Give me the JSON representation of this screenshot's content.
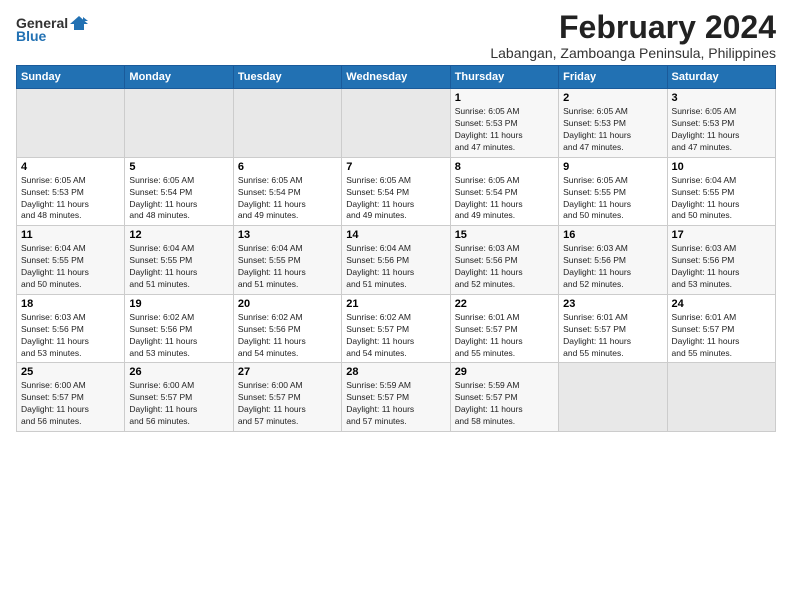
{
  "logo": {
    "text_general": "General",
    "text_blue": "Blue"
  },
  "title": "February 2024",
  "subtitle": "Labangan, Zamboanga Peninsula, Philippines",
  "days_of_week": [
    "Sunday",
    "Monday",
    "Tuesday",
    "Wednesday",
    "Thursday",
    "Friday",
    "Saturday"
  ],
  "weeks": [
    [
      {
        "day": "",
        "info": "",
        "empty": true
      },
      {
        "day": "",
        "info": "",
        "empty": true
      },
      {
        "day": "",
        "info": "",
        "empty": true
      },
      {
        "day": "",
        "info": "",
        "empty": true
      },
      {
        "day": "1",
        "info": "Sunrise: 6:05 AM\nSunset: 5:53 PM\nDaylight: 11 hours\nand 47 minutes."
      },
      {
        "day": "2",
        "info": "Sunrise: 6:05 AM\nSunset: 5:53 PM\nDaylight: 11 hours\nand 47 minutes."
      },
      {
        "day": "3",
        "info": "Sunrise: 6:05 AM\nSunset: 5:53 PM\nDaylight: 11 hours\nand 47 minutes."
      }
    ],
    [
      {
        "day": "4",
        "info": "Sunrise: 6:05 AM\nSunset: 5:53 PM\nDaylight: 11 hours\nand 48 minutes."
      },
      {
        "day": "5",
        "info": "Sunrise: 6:05 AM\nSunset: 5:54 PM\nDaylight: 11 hours\nand 48 minutes."
      },
      {
        "day": "6",
        "info": "Sunrise: 6:05 AM\nSunset: 5:54 PM\nDaylight: 11 hours\nand 49 minutes."
      },
      {
        "day": "7",
        "info": "Sunrise: 6:05 AM\nSunset: 5:54 PM\nDaylight: 11 hours\nand 49 minutes."
      },
      {
        "day": "8",
        "info": "Sunrise: 6:05 AM\nSunset: 5:54 PM\nDaylight: 11 hours\nand 49 minutes."
      },
      {
        "day": "9",
        "info": "Sunrise: 6:05 AM\nSunset: 5:55 PM\nDaylight: 11 hours\nand 50 minutes."
      },
      {
        "day": "10",
        "info": "Sunrise: 6:04 AM\nSunset: 5:55 PM\nDaylight: 11 hours\nand 50 minutes."
      }
    ],
    [
      {
        "day": "11",
        "info": "Sunrise: 6:04 AM\nSunset: 5:55 PM\nDaylight: 11 hours\nand 50 minutes."
      },
      {
        "day": "12",
        "info": "Sunrise: 6:04 AM\nSunset: 5:55 PM\nDaylight: 11 hours\nand 51 minutes."
      },
      {
        "day": "13",
        "info": "Sunrise: 6:04 AM\nSunset: 5:55 PM\nDaylight: 11 hours\nand 51 minutes."
      },
      {
        "day": "14",
        "info": "Sunrise: 6:04 AM\nSunset: 5:56 PM\nDaylight: 11 hours\nand 51 minutes."
      },
      {
        "day": "15",
        "info": "Sunrise: 6:03 AM\nSunset: 5:56 PM\nDaylight: 11 hours\nand 52 minutes."
      },
      {
        "day": "16",
        "info": "Sunrise: 6:03 AM\nSunset: 5:56 PM\nDaylight: 11 hours\nand 52 minutes."
      },
      {
        "day": "17",
        "info": "Sunrise: 6:03 AM\nSunset: 5:56 PM\nDaylight: 11 hours\nand 53 minutes."
      }
    ],
    [
      {
        "day": "18",
        "info": "Sunrise: 6:03 AM\nSunset: 5:56 PM\nDaylight: 11 hours\nand 53 minutes."
      },
      {
        "day": "19",
        "info": "Sunrise: 6:02 AM\nSunset: 5:56 PM\nDaylight: 11 hours\nand 53 minutes."
      },
      {
        "day": "20",
        "info": "Sunrise: 6:02 AM\nSunset: 5:56 PM\nDaylight: 11 hours\nand 54 minutes."
      },
      {
        "day": "21",
        "info": "Sunrise: 6:02 AM\nSunset: 5:57 PM\nDaylight: 11 hours\nand 54 minutes."
      },
      {
        "day": "22",
        "info": "Sunrise: 6:01 AM\nSunset: 5:57 PM\nDaylight: 11 hours\nand 55 minutes."
      },
      {
        "day": "23",
        "info": "Sunrise: 6:01 AM\nSunset: 5:57 PM\nDaylight: 11 hours\nand 55 minutes."
      },
      {
        "day": "24",
        "info": "Sunrise: 6:01 AM\nSunset: 5:57 PM\nDaylight: 11 hours\nand 55 minutes."
      }
    ],
    [
      {
        "day": "25",
        "info": "Sunrise: 6:00 AM\nSunset: 5:57 PM\nDaylight: 11 hours\nand 56 minutes."
      },
      {
        "day": "26",
        "info": "Sunrise: 6:00 AM\nSunset: 5:57 PM\nDaylight: 11 hours\nand 56 minutes."
      },
      {
        "day": "27",
        "info": "Sunrise: 6:00 AM\nSunset: 5:57 PM\nDaylight: 11 hours\nand 57 minutes."
      },
      {
        "day": "28",
        "info": "Sunrise: 5:59 AM\nSunset: 5:57 PM\nDaylight: 11 hours\nand 57 minutes."
      },
      {
        "day": "29",
        "info": "Sunrise: 5:59 AM\nSunset: 5:57 PM\nDaylight: 11 hours\nand 58 minutes."
      },
      {
        "day": "",
        "info": "",
        "empty": true
      },
      {
        "day": "",
        "info": "",
        "empty": true
      }
    ]
  ]
}
